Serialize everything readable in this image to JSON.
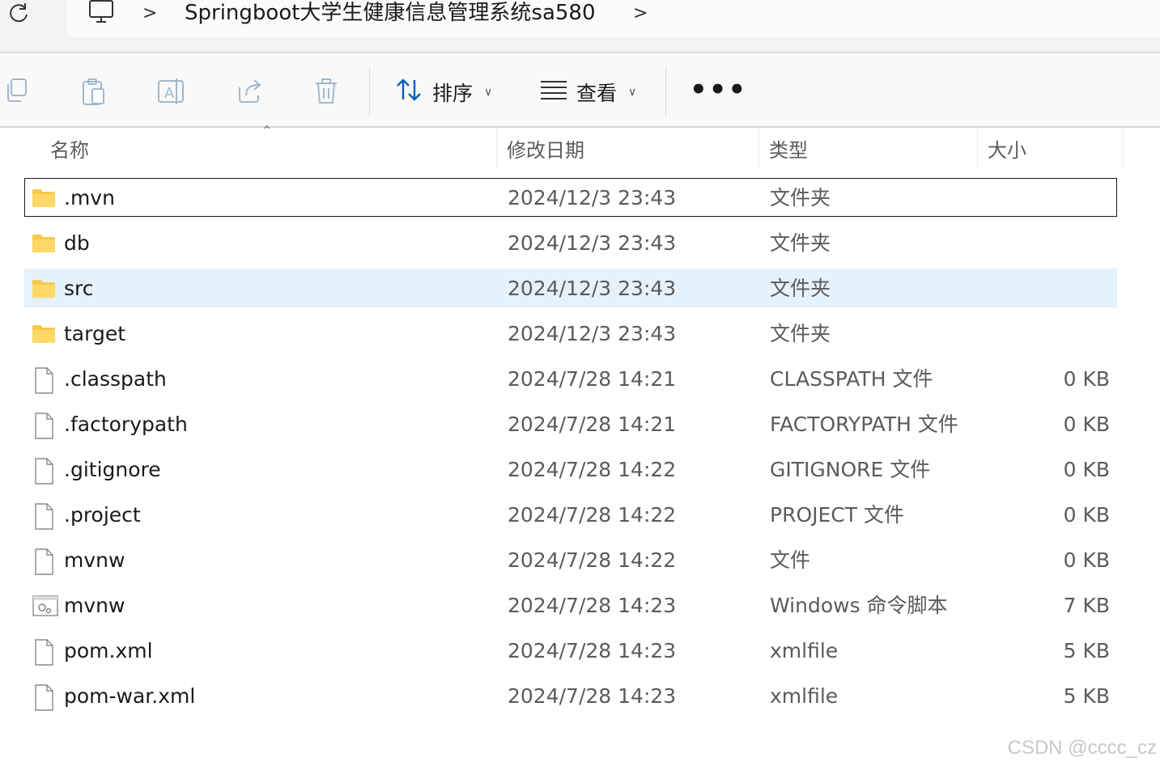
{
  "breadcrumb": {
    "path": "Springboot大学生健康信息管理系统sa580"
  },
  "toolbar": {
    "sort_label": "排序",
    "view_label": "查看",
    "more_label": "•••"
  },
  "columns": {
    "name": "名称",
    "date": "修改日期",
    "type": "类型",
    "size": "大小"
  },
  "files": [
    {
      "name": ".mvn",
      "date": "2024/12/3 23:43",
      "type": "文件夹",
      "size": "",
      "icon": "folder-icon",
      "state": "focused"
    },
    {
      "name": "db",
      "date": "2024/12/3 23:43",
      "type": "文件夹",
      "size": "",
      "icon": "folder-icon",
      "state": ""
    },
    {
      "name": "src",
      "date": "2024/12/3 23:43",
      "type": "文件夹",
      "size": "",
      "icon": "folder-icon",
      "state": "selected"
    },
    {
      "name": "target",
      "date": "2024/12/3 23:43",
      "type": "文件夹",
      "size": "",
      "icon": "folder-icon",
      "state": ""
    },
    {
      "name": ".classpath",
      "date": "2024/7/28 14:21",
      "type": "CLASSPATH 文件",
      "size": "0 KB",
      "icon": "file-icon",
      "state": ""
    },
    {
      "name": ".factorypath",
      "date": "2024/7/28 14:21",
      "type": "FACTORYPATH 文件",
      "size": "0 KB",
      "icon": "file-icon",
      "state": ""
    },
    {
      "name": ".gitignore",
      "date": "2024/7/28 14:22",
      "type": "GITIGNORE 文件",
      "size": "0 KB",
      "icon": "file-icon",
      "state": ""
    },
    {
      "name": ".project",
      "date": "2024/7/28 14:22",
      "type": "PROJECT 文件",
      "size": "0 KB",
      "icon": "file-icon",
      "state": ""
    },
    {
      "name": "mvnw",
      "date": "2024/7/28 14:22",
      "type": "文件",
      "size": "0 KB",
      "icon": "file-icon",
      "state": ""
    },
    {
      "name": "mvnw",
      "date": "2024/7/28 14:23",
      "type": "Windows 命令脚本",
      "size": "7 KB",
      "icon": "script-icon",
      "state": ""
    },
    {
      "name": "pom.xml",
      "date": "2024/7/28 14:23",
      "type": "xmlfile",
      "size": "5 KB",
      "icon": "file-icon",
      "state": ""
    },
    {
      "name": "pom-war.xml",
      "date": "2024/7/28 14:23",
      "type": "xmlfile",
      "size": "5 KB",
      "icon": "file-icon",
      "state": ""
    }
  ],
  "watermark": "CSDN @cccc_cz",
  "colors": {
    "selected_bg": "#e5f1fb",
    "folder": "#f8c94d",
    "accent": "#005fb8"
  }
}
